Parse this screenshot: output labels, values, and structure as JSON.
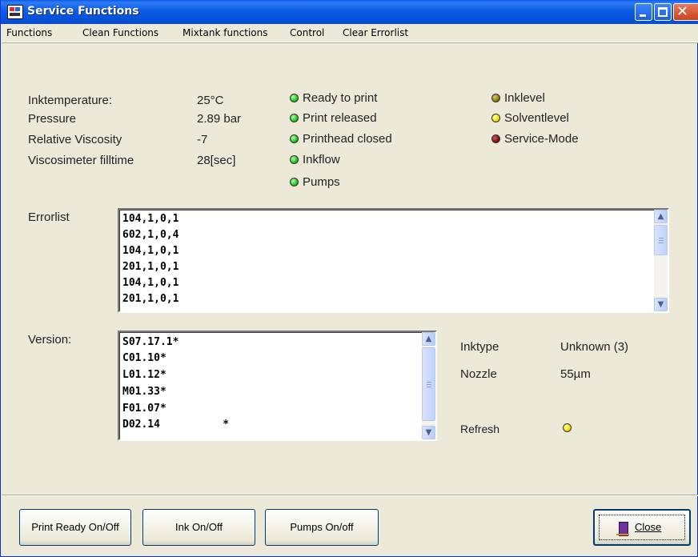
{
  "window": {
    "title": "Service Functions"
  },
  "menu": [
    "Functions",
    "Clean Functions",
    "Mixtank functions",
    "Control",
    "Clear Errorlist"
  ],
  "readings": [
    {
      "label": "Inktemperature:",
      "value": "25°C"
    },
    {
      "label": "Pressure",
      "value": "2.89 bar"
    },
    {
      "label": "Relative Viscosity",
      "value": "-7"
    },
    {
      "label": "Viscosimeter filltime",
      "value": "28[sec]"
    }
  ],
  "status_left": [
    {
      "label": "Ready to print",
      "color": "#1ac81a"
    },
    {
      "label": "Print released",
      "color": "#1ac81a"
    },
    {
      "label": "Printhead closed",
      "color": "#1ac81a"
    },
    {
      "label": "Inkflow",
      "color": "#1ac81a"
    },
    {
      "label": "Pumps",
      "color": "#1ac81a"
    }
  ],
  "status_right": [
    {
      "label": "Inklevel",
      "color": "#8a7a10"
    },
    {
      "label": "Solventlevel",
      "color": "#f0e000"
    },
    {
      "label": "Service-Mode",
      "color": "#8a0a0a"
    }
  ],
  "errorlist": {
    "label": "Errorlist",
    "lines": [
      "104,1,0,1",
      "602,1,0,4",
      "104,1,0,1",
      "201,1,0,1",
      "104,1,0,1",
      "201,1,0,1"
    ]
  },
  "version": {
    "label": "Version:",
    "lines": [
      "S07.17.1*",
      "C01.10*",
      "L01.12*",
      "M01.33*",
      "F01.07*",
      "D02.14          *"
    ]
  },
  "info": {
    "inktype_label": "Inktype",
    "inktype_value": "Unknown (3)",
    "nozzle_label": "Nozzle",
    "nozzle_value": "55µm",
    "refresh_label": "Refresh"
  },
  "buttons": {
    "print_ready": "Print Ready On/Off",
    "ink": "Ink On/Off",
    "pumps": "Pumps On/off",
    "close": "Close"
  }
}
